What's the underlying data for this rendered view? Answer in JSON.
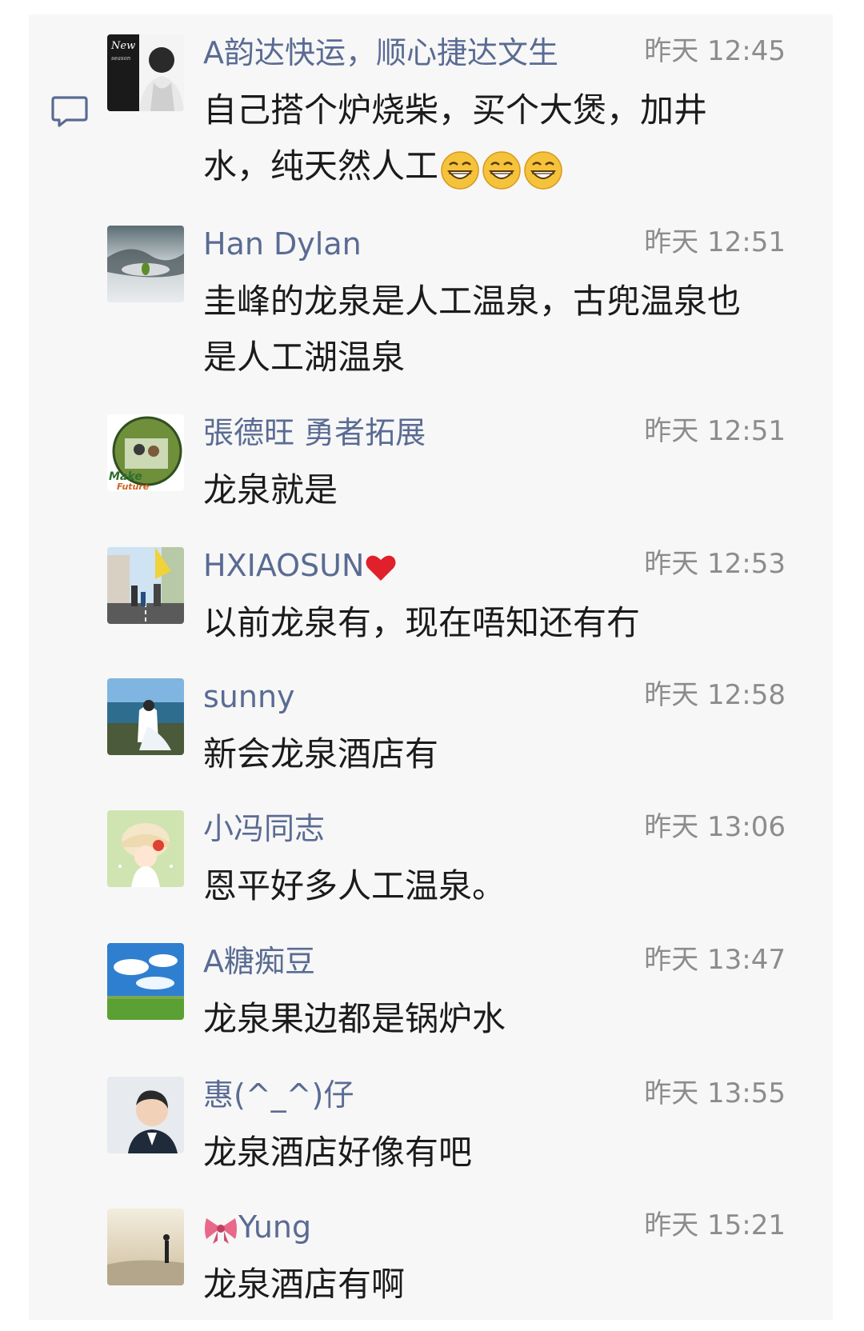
{
  "comments": [
    {
      "name": "A韵达快运，顺心捷达文生",
      "time": "昨天 12:45",
      "text": "自己搭个炉烧柴，买个大煲，加井\n水，纯天然人工",
      "emoji_count": 3,
      "avatar": "portrait-man-black-white"
    },
    {
      "name": "Han  Dylan",
      "time": "昨天 12:51",
      "text": "圭峰的龙泉是人工温泉，古兜温泉也\n是人工湖温泉",
      "avatar": "misty-landscape-leaf"
    },
    {
      "name": "張德旺 勇者拓展",
      "time": "昨天 12:51",
      "text": "龙泉就是",
      "avatar": "outdoor-group-circle"
    },
    {
      "name": "HXIAOSUN",
      "time": "昨天 12:53",
      "text": "以前龙泉有，现在唔知还有冇",
      "name_suffix_icon": "heart-icon",
      "avatar": "family-street"
    },
    {
      "name": "sunny",
      "time": "昨天 12:58",
      "text": "新会龙泉酒店有",
      "avatar": "couple-seaside"
    },
    {
      "name": "小冯同志",
      "time": "昨天 13:06",
      "text": "恩平好多人工温泉。",
      "avatar": "cartoon-child-hat"
    },
    {
      "name": "A糖痴豆",
      "time": "昨天 13:47",
      "text": "龙泉果边都是锅炉水",
      "avatar": "blue-sky-field"
    },
    {
      "name": "惠(^_^)仔",
      "time": "昨天 13:55",
      "text": "龙泉酒店好像有吧",
      "avatar": "man-portrait-suit"
    },
    {
      "name": "Yung",
      "time": "昨天 15:21",
      "text": "龙泉酒店有啊",
      "name_prefix_icon": "ribbon-bow-icon",
      "avatar": "sunset-silhouette"
    }
  ],
  "icons": {
    "comment": "comment-bubble-icon",
    "emoji": "grinning-face-icon"
  },
  "colors": {
    "name": "#5a6b93",
    "time": "#8c8c8c",
    "text": "#1b1b1b",
    "icon": "#5a6b93",
    "panel": "#f7f7f7"
  }
}
